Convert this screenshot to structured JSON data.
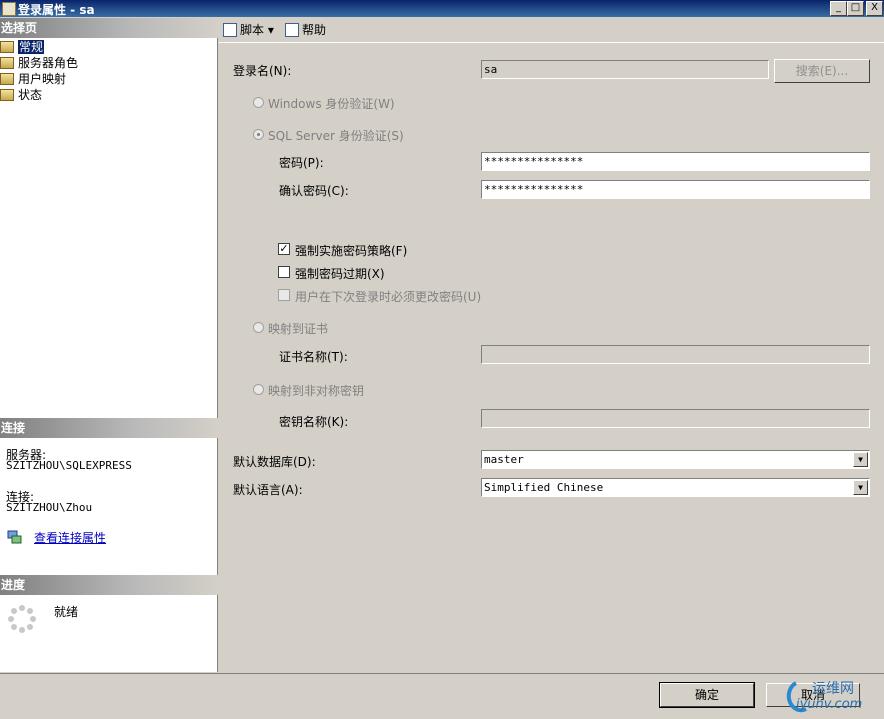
{
  "window": {
    "title": "登录属性 - sa"
  },
  "titlebar_buttons": {
    "minimize": "_",
    "restore": "□",
    "close": "X"
  },
  "left": {
    "select_page_header": "选择页",
    "pages": [
      "常规",
      "服务器角色",
      "用户映射",
      "状态"
    ],
    "connection_header": "连接",
    "server_label": "服务器:",
    "server_value": "SZITZHOU\\SQLEXPRESS",
    "connection_label": "连接:",
    "connection_value": "SZITZHOU\\Zhou",
    "view_link": "查看连接属性",
    "progress_header": "进度",
    "progress_status": "就绪"
  },
  "toolbar": {
    "script": "脚本",
    "help": "帮助",
    "dropdown_arrow": "▾"
  },
  "form": {
    "login_name_label": "登录名(N):",
    "login_name_value": "sa",
    "search_button": "搜索(E)...",
    "windows_auth": "Windows 身份验证(W)",
    "sql_auth": "SQL Server 身份验证(S)",
    "password_label": "密码(P):",
    "password_value": "***************",
    "confirm_label": "确认密码(C):",
    "confirm_value": "***************",
    "enforce_policy": "强制实施密码策略(F)",
    "enforce_policy_checked": true,
    "enforce_expiration": "强制密码过期(X)",
    "enforce_expiration_checked": false,
    "must_change": "用户在下次登录时必须更改密码(U)",
    "must_change_checked": false,
    "map_cert": "映射到证书",
    "cert_name_label": "证书名称(T):",
    "map_key": "映射到非对称密钥",
    "key_name_label": "密钥名称(K):",
    "default_db_label": "默认数据库(D):",
    "default_db_value": "master",
    "default_lang_label": "默认语言(A):",
    "default_lang_value": "Simplified Chinese",
    "combo_arrow": "▼",
    "check_mark": "✓"
  },
  "buttons": {
    "ok": "确定",
    "cancel": "取消"
  },
  "watermark": {
    "text": "运维网",
    "sub": "iyunv.com"
  }
}
